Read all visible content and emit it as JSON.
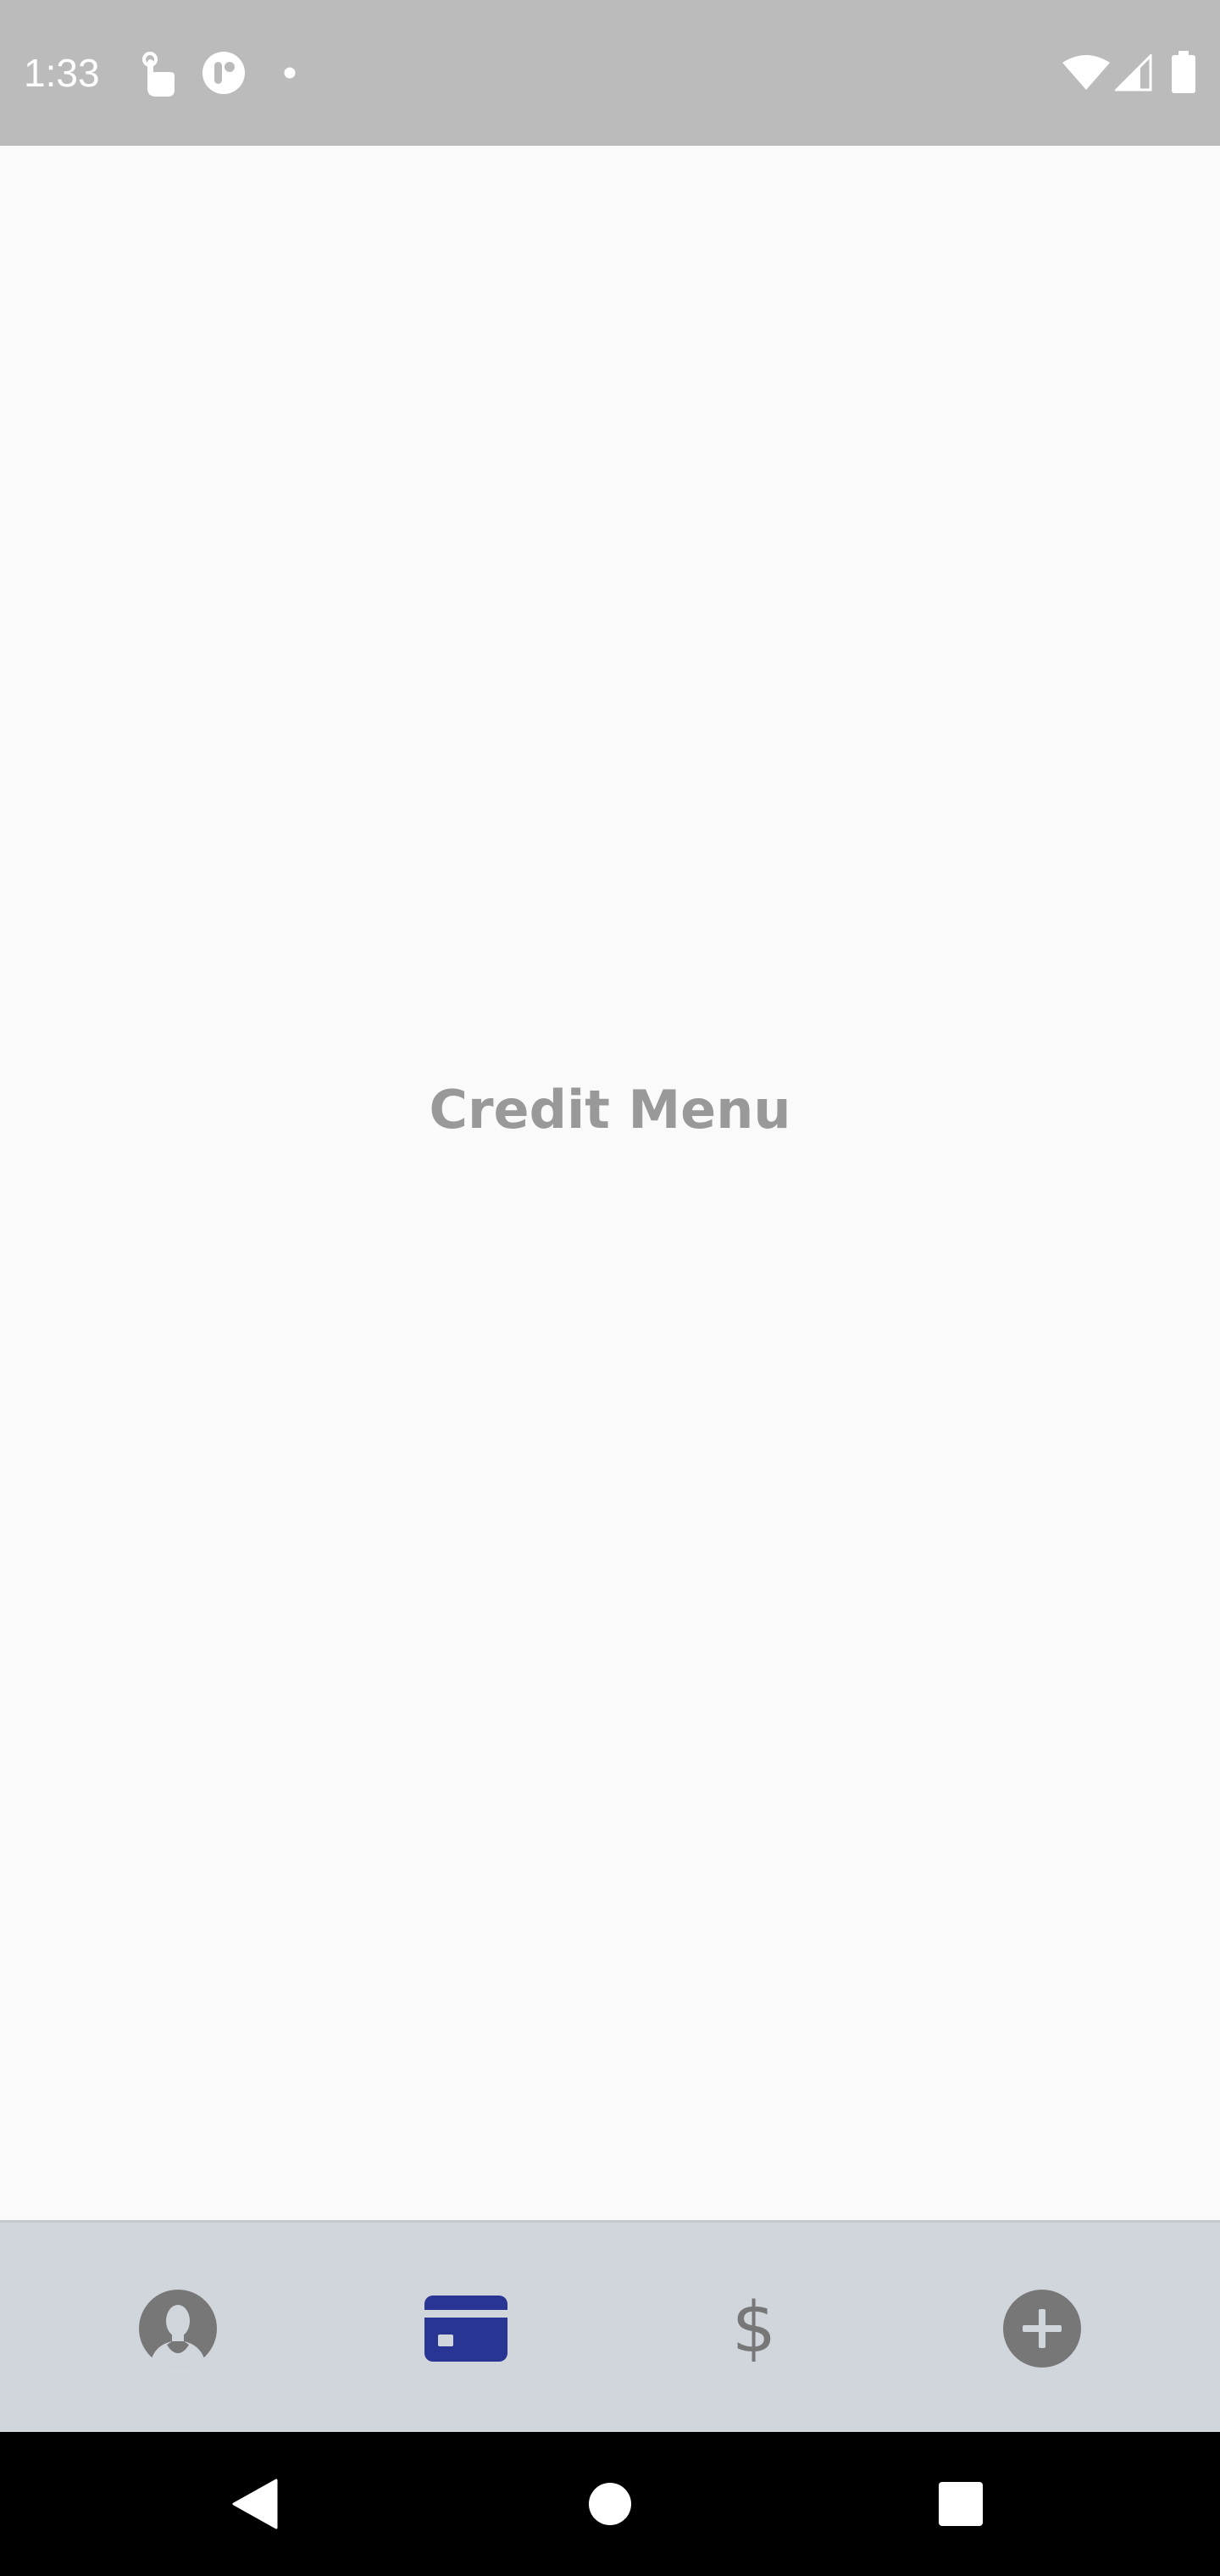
{
  "status_bar": {
    "time": "1:33",
    "left_icons": [
      "touch-icon",
      "app-notification-icon",
      "dot-icon"
    ],
    "right_icons": [
      "wifi-icon",
      "cellular-signal-icon",
      "battery-icon"
    ]
  },
  "main": {
    "title": "Credit Menu"
  },
  "bottom_nav": {
    "items": [
      {
        "icon": "profile-icon",
        "active": false
      },
      {
        "icon": "credit-card-icon",
        "active": true
      },
      {
        "icon": "dollar-icon",
        "label": "$",
        "active": false
      },
      {
        "icon": "add-circle-icon",
        "active": false
      }
    ],
    "active_color": "#283593",
    "inactive_color": "#777777"
  },
  "system_nav": {
    "buttons": [
      "back-icon",
      "home-icon",
      "recents-icon"
    ]
  }
}
